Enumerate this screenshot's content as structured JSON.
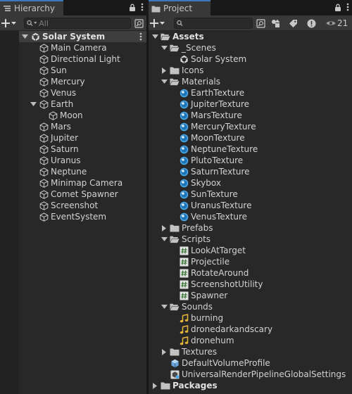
{
  "hierarchy": {
    "tab_label": "Hierarchy",
    "search_placeholder": "All",
    "scene_name": "Solar System",
    "items": [
      {
        "label": "Main Camera",
        "depth": 1
      },
      {
        "label": "Directional Light",
        "depth": 1
      },
      {
        "label": "Sun",
        "depth": 1
      },
      {
        "label": "Mercury",
        "depth": 1
      },
      {
        "label": "Venus",
        "depth": 1
      },
      {
        "label": "Earth",
        "depth": 1,
        "expanded": true
      },
      {
        "label": "Moon",
        "depth": 2
      },
      {
        "label": "Mars",
        "depth": 1
      },
      {
        "label": "Jupiter",
        "depth": 1
      },
      {
        "label": "Saturn",
        "depth": 1
      },
      {
        "label": "Uranus",
        "depth": 1
      },
      {
        "label": "Neptune",
        "depth": 1
      },
      {
        "label": "Minimap Camera",
        "depth": 1
      },
      {
        "label": "Comet Spawner",
        "depth": 1
      },
      {
        "label": "Screenshot",
        "depth": 1
      },
      {
        "label": "EventSystem",
        "depth": 1
      }
    ]
  },
  "project": {
    "tab_label": "Project",
    "hidden_count": "21",
    "items": [
      {
        "label": "Assets",
        "depth": 0,
        "kind": "folder-open",
        "bold": true
      },
      {
        "label": "_Scenes",
        "depth": 1,
        "kind": "folder-open"
      },
      {
        "label": "Solar System",
        "depth": 2,
        "kind": "scene"
      },
      {
        "label": "Icons",
        "depth": 1,
        "kind": "folder"
      },
      {
        "label": "Materials",
        "depth": 1,
        "kind": "folder-open"
      },
      {
        "label": "EarthTexture",
        "depth": 2,
        "kind": "material"
      },
      {
        "label": "JupiterTexture",
        "depth": 2,
        "kind": "material"
      },
      {
        "label": "MarsTexture",
        "depth": 2,
        "kind": "material"
      },
      {
        "label": "MercuryTexture",
        "depth": 2,
        "kind": "material"
      },
      {
        "label": "MoonTexture",
        "depth": 2,
        "kind": "material"
      },
      {
        "label": "NeptuneTexture",
        "depth": 2,
        "kind": "material"
      },
      {
        "label": "PlutoTexture",
        "depth": 2,
        "kind": "material"
      },
      {
        "label": "SaturnTexture",
        "depth": 2,
        "kind": "material"
      },
      {
        "label": "Skybox",
        "depth": 2,
        "kind": "material"
      },
      {
        "label": "SunTexture",
        "depth": 2,
        "kind": "material"
      },
      {
        "label": "UranusTexture",
        "depth": 2,
        "kind": "material"
      },
      {
        "label": "VenusTexture",
        "depth": 2,
        "kind": "material"
      },
      {
        "label": "Prefabs",
        "depth": 1,
        "kind": "folder"
      },
      {
        "label": "Scripts",
        "depth": 1,
        "kind": "folder-open"
      },
      {
        "label": "LookAtTarget",
        "depth": 2,
        "kind": "script"
      },
      {
        "label": "Projectile",
        "depth": 2,
        "kind": "script"
      },
      {
        "label": "RotateAround",
        "depth": 2,
        "kind": "script"
      },
      {
        "label": "ScreenshotUtility",
        "depth": 2,
        "kind": "script"
      },
      {
        "label": "Spawner",
        "depth": 2,
        "kind": "script"
      },
      {
        "label": "Sounds",
        "depth": 1,
        "kind": "folder-open"
      },
      {
        "label": "burning",
        "depth": 2,
        "kind": "audio"
      },
      {
        "label": "dronedarkandscary",
        "depth": 2,
        "kind": "audio"
      },
      {
        "label": "dronehum",
        "depth": 2,
        "kind": "audio"
      },
      {
        "label": "Textures",
        "depth": 1,
        "kind": "folder"
      },
      {
        "label": "DefaultVolumeProfile",
        "depth": 1,
        "kind": "volume"
      },
      {
        "label": "UniversalRenderPipelineGlobalSettings",
        "depth": 1,
        "kind": "urp"
      },
      {
        "label": "Packages",
        "depth": 0,
        "kind": "folder",
        "bold": true
      }
    ]
  },
  "colors": {
    "panel_bg": "#282828",
    "toolbar_bg": "#383838",
    "tab_accent": "#3a79bb",
    "material_blue": "#4aa8e8",
    "script_green": "#7fc97f",
    "audio_yellow": "#e8b83a"
  }
}
